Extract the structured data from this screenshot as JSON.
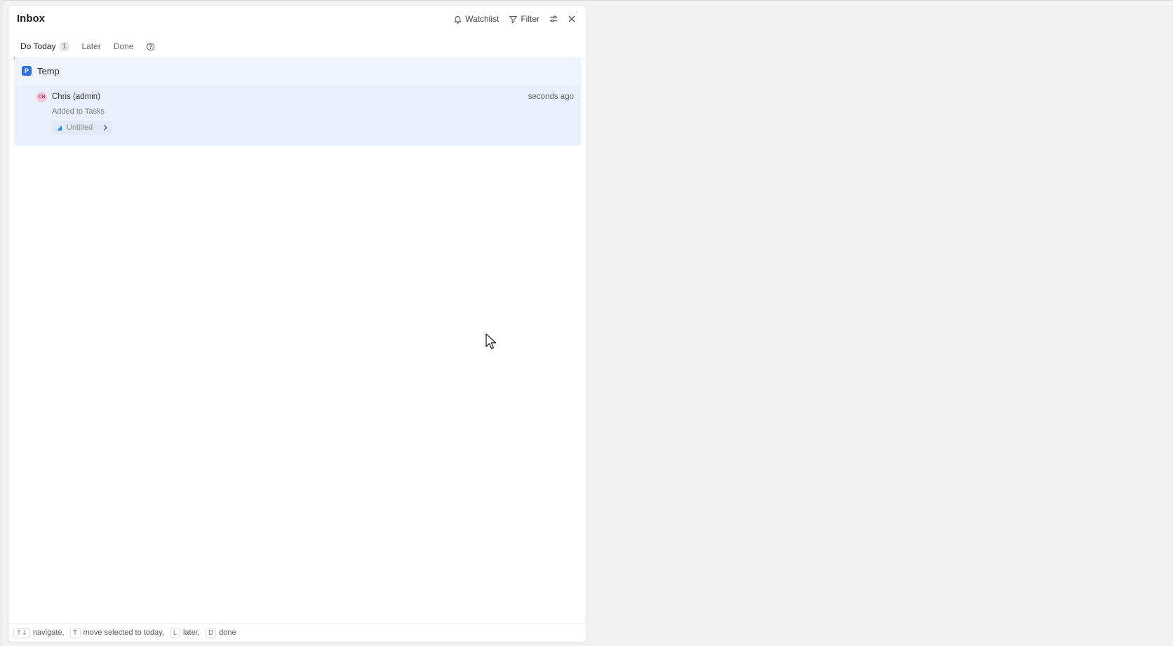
{
  "header": {
    "title": "Inbox",
    "watchlist_label": "Watchlist",
    "filter_label": "Filter"
  },
  "tabs": [
    {
      "label": "Do Today",
      "count": "1",
      "active": true
    },
    {
      "label": "Later",
      "active": false
    },
    {
      "label": "Done",
      "active": false
    }
  ],
  "group": {
    "project_icon_letter": "P",
    "name": "Temp",
    "notification": {
      "avatar_initials": "CH",
      "actor": "Chris (admin)",
      "time": "seconds ago",
      "action": "Added to Tasks",
      "task_name": "Untitled"
    }
  },
  "footer": {
    "nav_key": "↑↓",
    "nav_label": "navigate,",
    "today_key": "T",
    "today_label": "move selected to today,",
    "later_key": "L",
    "later_label": "later,",
    "done_key": "D",
    "done_label": "done"
  },
  "colors": {
    "accent": "#2f6fe4",
    "group_bg": "#e9f0fc",
    "avatar_bg": "#f6c6d6"
  }
}
